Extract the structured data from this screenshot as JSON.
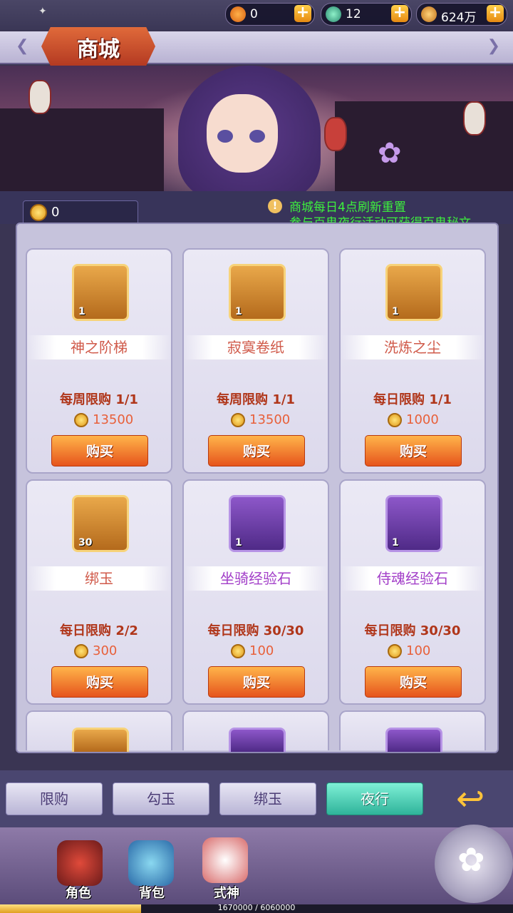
{
  "currencies": [
    {
      "name": "soul-jade",
      "icon": "orange-flame-icon",
      "value": "0"
    },
    {
      "name": "hook-jade",
      "icon": "green-jade-icon",
      "value": "12"
    },
    {
      "name": "gold",
      "icon": "gold-coin-icon",
      "value": "624万"
    }
  ],
  "header": {
    "title": "商城"
  },
  "coupon": {
    "icon": "demon-coin-icon",
    "value": "0"
  },
  "notice": {
    "line1": "商城每日4点刷新重置",
    "line2": "参与百鬼夜行活动可获得百鬼秘文"
  },
  "items": [
    {
      "name": "神之阶梯",
      "qty": "1",
      "frame": "gold",
      "limit": "每周限购  1/1",
      "price": "13500",
      "buy": "购买",
      "icon": "ring-icon"
    },
    {
      "name": "寂寞卷纸",
      "qty": "1",
      "frame": "gold",
      "limit": "每周限购  1/1",
      "price": "13500",
      "buy": "购买",
      "icon": "scroll-icon"
    },
    {
      "name": "洗炼之尘",
      "qty": "1",
      "frame": "gold",
      "limit": "每日限购  1/1",
      "price": "1000",
      "buy": "购买",
      "icon": "crystal-dust-icon"
    },
    {
      "name": "绑玉",
      "qty": "30",
      "frame": "gold",
      "limit": "每日限购  2/2",
      "price": "300",
      "buy": "购买",
      "icon": "bound-jade-icon"
    },
    {
      "name": "坐骑经验石",
      "qty": "1",
      "frame": "purple",
      "limit": "每日限购  30/30",
      "price": "100",
      "buy": "购买",
      "icon": "mount-stone-icon"
    },
    {
      "name": "侍魂经验石",
      "qty": "1",
      "frame": "purple",
      "limit": "每日限购  30/30",
      "price": "100",
      "buy": "购买",
      "icon": "soul-stone-icon"
    }
  ],
  "tabs": [
    "限购",
    "勾玉",
    "绑玉",
    "夜行"
  ],
  "active_tab": "夜行",
  "nav": [
    {
      "label": "角色",
      "icon": "character-icon"
    },
    {
      "label": "背包",
      "icon": "backpack-icon"
    },
    {
      "label": "式神",
      "icon": "shikigami-icon"
    }
  ],
  "xp": {
    "text": "1670000 / 6060000",
    "fraction": 0.2756
  },
  "colors": {
    "notice": "#3df03d",
    "active_tab": "#2fb39a",
    "buy_button": "#e6541c",
    "title": "#b43a22"
  }
}
